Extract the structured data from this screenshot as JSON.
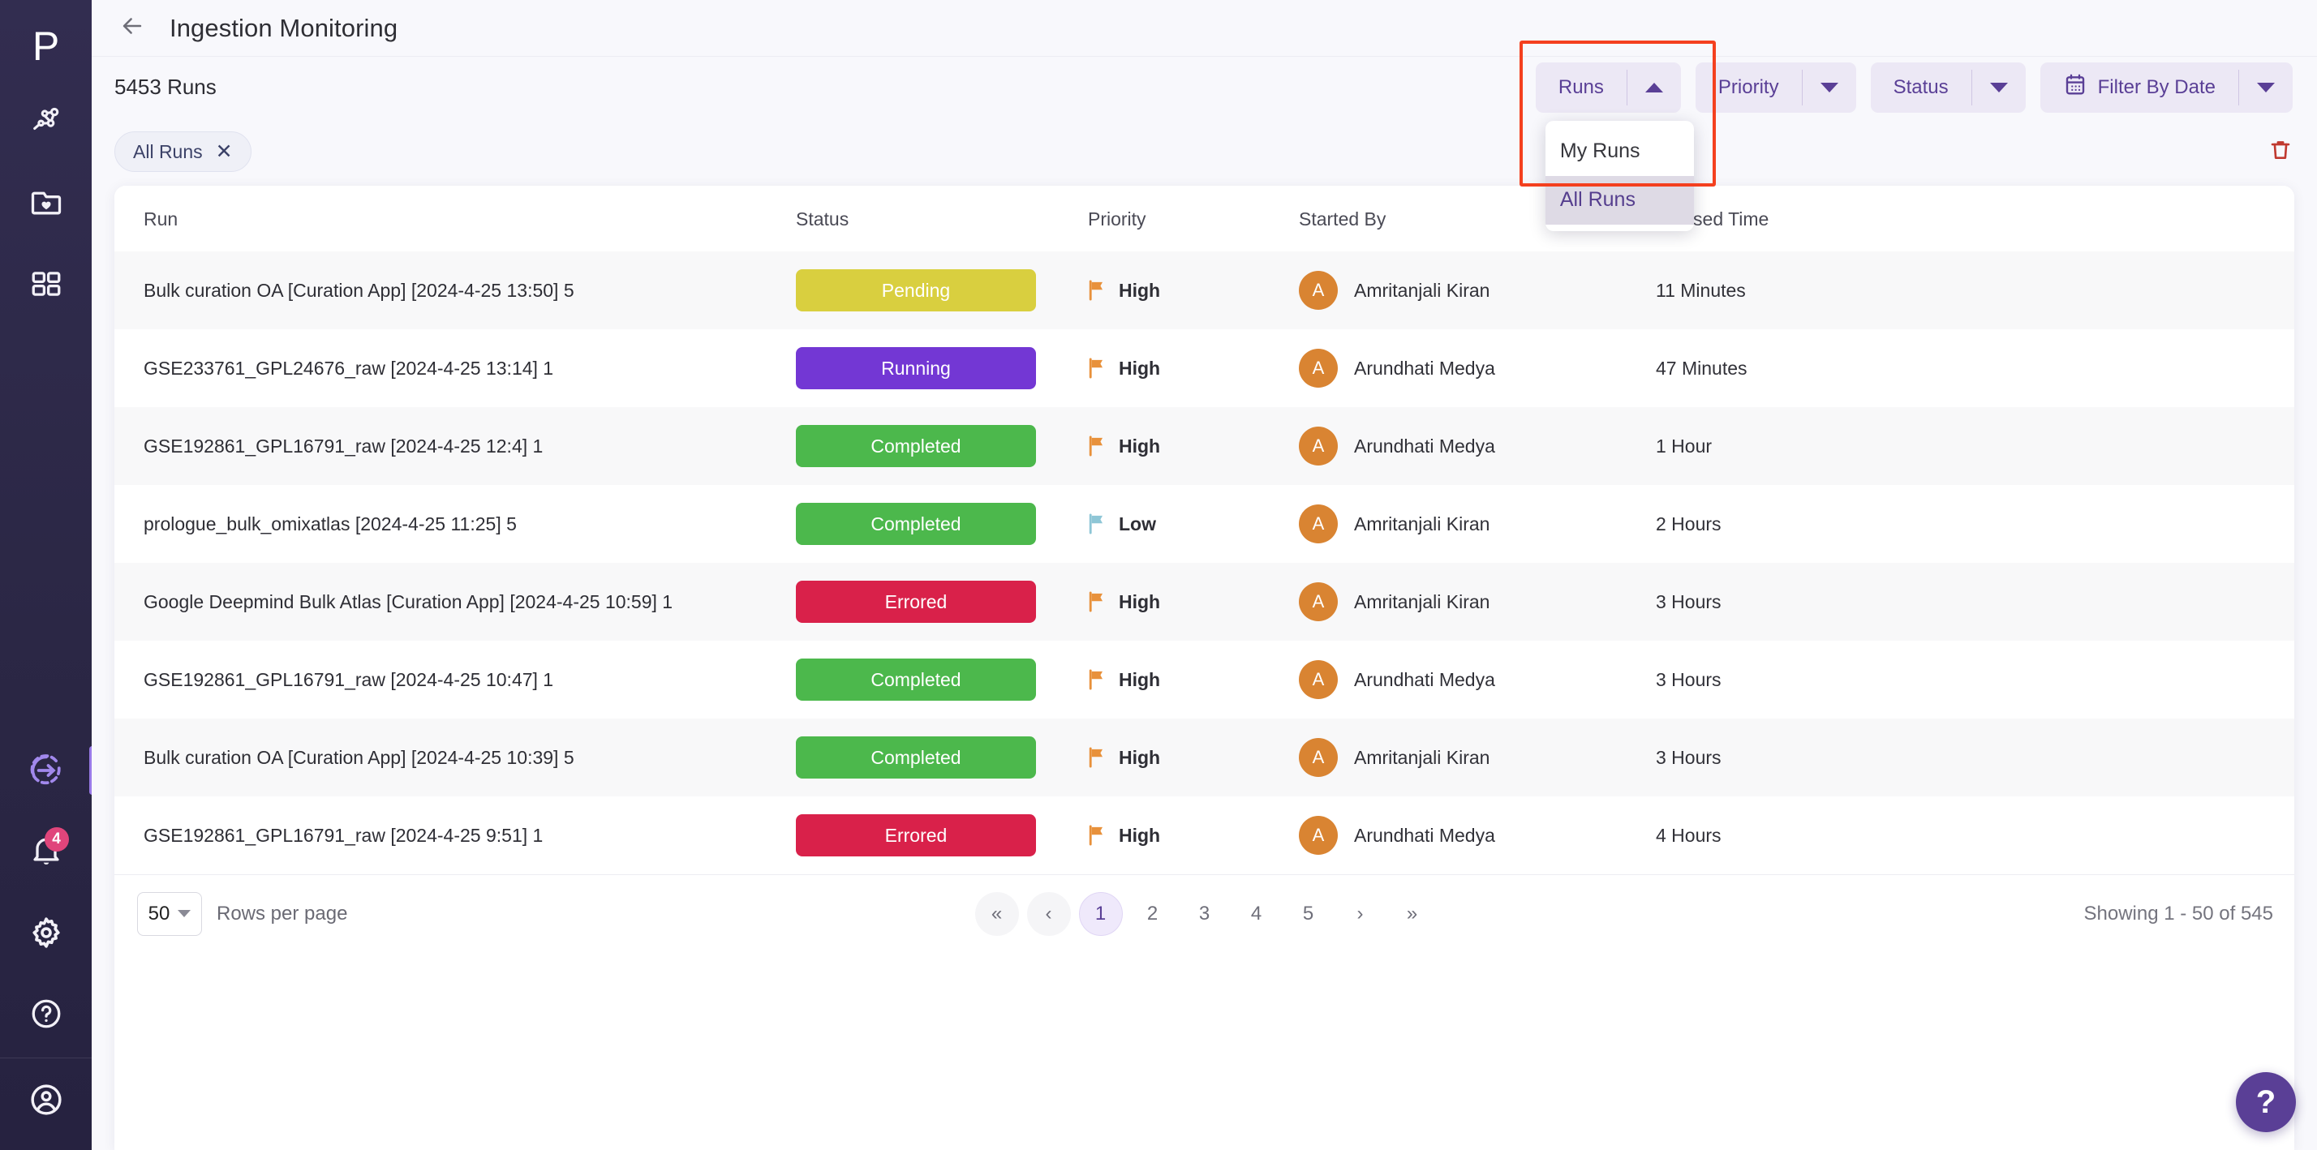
{
  "brand": {
    "logo_letter": "P",
    "accent": "#5a3f96"
  },
  "sidebar": {
    "items": [
      {
        "name": "network-icon",
        "label": "Network"
      },
      {
        "name": "folder-heart-icon",
        "label": "Saved"
      },
      {
        "name": "grid-apps-icon",
        "label": "Apps"
      }
    ],
    "bottom_items": [
      {
        "name": "run-arrow-icon",
        "label": "Runs",
        "active": true
      },
      {
        "name": "bell-icon",
        "label": "Notifications",
        "badge": "4"
      },
      {
        "name": "gear-icon",
        "label": "Settings"
      },
      {
        "name": "help-circle-icon",
        "label": "Help"
      },
      {
        "name": "user-avatar-icon",
        "label": "Account"
      }
    ]
  },
  "header": {
    "back_icon": "arrow-left-icon",
    "title": "Ingestion Monitoring"
  },
  "filterbar": {
    "runs_count": "5453 Runs",
    "dropdowns": [
      {
        "label": "Runs",
        "caret": "up",
        "open": true
      },
      {
        "label": "Priority",
        "caret": "down",
        "open": false
      },
      {
        "label": "Status",
        "caret": "down",
        "open": false
      },
      {
        "label": "Filter By Date",
        "caret": "down",
        "open": false,
        "icon": "calendar-icon"
      }
    ],
    "runs_menu": {
      "items": [
        {
          "label": "My Runs",
          "selected": false
        },
        {
          "label": "All Runs",
          "selected": true
        }
      ]
    },
    "highlight_color": "#f4401f"
  },
  "chips": {
    "active": {
      "label": "All Runs",
      "close_icon": "close-icon"
    },
    "clear_icon": "trash-icon"
  },
  "table": {
    "columns": [
      "Run",
      "Status",
      "Priority",
      "Started By",
      "Elapsed Time"
    ],
    "status_colors": {
      "Pending": "#d9cf3f",
      "Running": "#7337d4",
      "Completed": "#4cb84c",
      "Errored": "#d9214a"
    },
    "priority_colors": {
      "High": "#e8913b",
      "Low": "#8ec6d6"
    },
    "rows": [
      {
        "run": "Bulk curation OA [Curation App] [2024-4-25 13:50] 5",
        "status": "Pending",
        "priority": "High",
        "started_by": "Amritanjali Kiran",
        "avatar": "A",
        "elapsed": "11 Minutes"
      },
      {
        "run": "GSE233761_GPL24676_raw [2024-4-25 13:14] 1",
        "status": "Running",
        "priority": "High",
        "started_by": "Arundhati Medya",
        "avatar": "A",
        "elapsed": "47 Minutes"
      },
      {
        "run": "GSE192861_GPL16791_raw [2024-4-25 12:4] 1",
        "status": "Completed",
        "priority": "High",
        "started_by": "Arundhati Medya",
        "avatar": "A",
        "elapsed": "1 Hour"
      },
      {
        "run": "prologue_bulk_omixatlas [2024-4-25 11:25] 5",
        "status": "Completed",
        "priority": "Low",
        "started_by": "Amritanjali Kiran",
        "avatar": "A",
        "elapsed": "2 Hours"
      },
      {
        "run": "Google Deepmind Bulk Atlas [Curation App] [2024-4-25 10:59] 1",
        "status": "Errored",
        "priority": "High",
        "started_by": "Amritanjali Kiran",
        "avatar": "A",
        "elapsed": "3 Hours"
      },
      {
        "run": "GSE192861_GPL16791_raw [2024-4-25 10:47] 1",
        "status": "Completed",
        "priority": "High",
        "started_by": "Arundhati Medya",
        "avatar": "A",
        "elapsed": "3 Hours"
      },
      {
        "run": "Bulk curation OA [Curation App] [2024-4-25 10:39] 5",
        "status": "Completed",
        "priority": "High",
        "started_by": "Amritanjali Kiran",
        "avatar": "A",
        "elapsed": "3 Hours"
      },
      {
        "run": "GSE192861_GPL16791_raw [2024-4-25 9:51] 1",
        "status": "Errored",
        "priority": "High",
        "started_by": "Arundhati Medya",
        "avatar": "A",
        "elapsed": "4 Hours"
      }
    ]
  },
  "footer": {
    "rows_per_page_value": "50",
    "rows_per_page_label": "Rows per page",
    "pages": [
      "1",
      "2",
      "3",
      "4",
      "5"
    ],
    "current_page": "1",
    "first_icon": "«",
    "prev_icon": "‹",
    "next_icon": "›",
    "last_icon": "»",
    "showing": "Showing 1 - 50 of 545"
  },
  "help_fab": {
    "label": "?"
  }
}
